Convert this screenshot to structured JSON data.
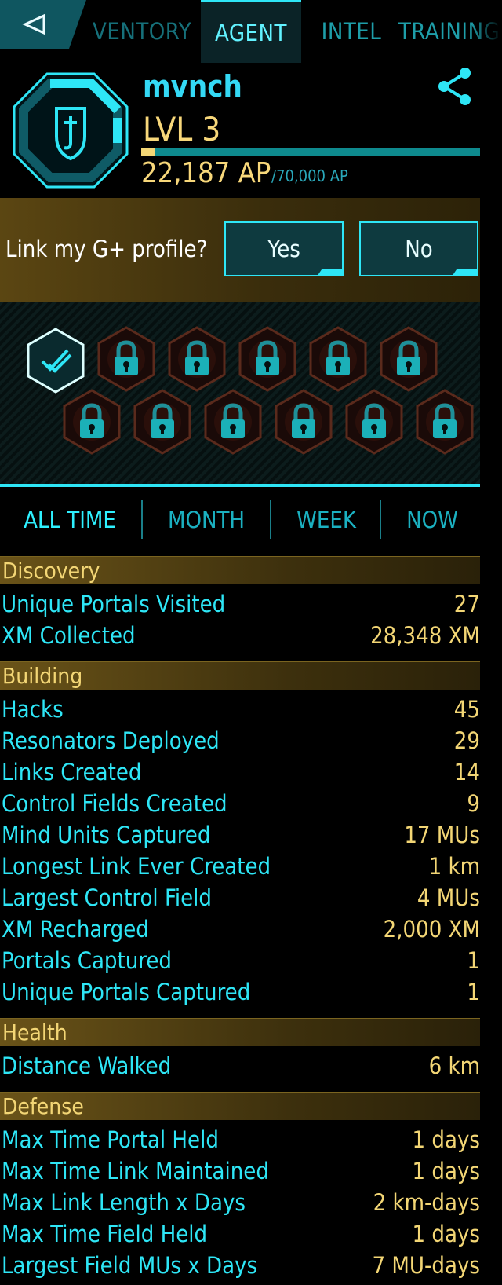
{
  "tabs": {
    "inventory": "VENTORY",
    "agent": "AGENT",
    "intel": "INTEL",
    "training": "TRAINING"
  },
  "agent": {
    "name": "mvnch",
    "level": "LVL 3",
    "ap": "22,187 AP",
    "ap_max": "/70,000 AP",
    "level_progress_fraction": 0.04
  },
  "gplus": {
    "prompt": "Link my G+ profile?",
    "yes": "Yes",
    "no": "No"
  },
  "badges": {
    "unlocked_icon": "double-check-badge-icon",
    "locked_icon": "lock-badge-icon",
    "row1_count": 6,
    "row2_count": 6
  },
  "periods": [
    "ALL TIME",
    "MONTH",
    "WEEK",
    "NOW"
  ],
  "stats": {
    "discovery": {
      "title": "Discovery",
      "rows": [
        {
          "label": "Unique Portals Visited",
          "value": "27"
        },
        {
          "label": "XM Collected",
          "value": "28,348 XM"
        }
      ]
    },
    "building": {
      "title": "Building",
      "rows": [
        {
          "label": "Hacks",
          "value": "45"
        },
        {
          "label": "Resonators Deployed",
          "value": "29"
        },
        {
          "label": "Links Created",
          "value": "14"
        },
        {
          "label": "Control Fields Created",
          "value": "9"
        },
        {
          "label": "Mind Units Captured",
          "value": "17 MUs"
        },
        {
          "label": "Longest Link Ever Created",
          "value": "1 km"
        },
        {
          "label": "Largest Control Field",
          "value": "4 MUs"
        },
        {
          "label": "XM Recharged",
          "value": "2,000 XM"
        },
        {
          "label": "Portals Captured",
          "value": "1"
        },
        {
          "label": "Unique Portals Captured",
          "value": "1"
        }
      ]
    },
    "health": {
      "title": "Health",
      "rows": [
        {
          "label": "Distance Walked",
          "value": "6 km"
        }
      ]
    },
    "defense": {
      "title": "Defense",
      "rows": [
        {
          "label": "Max Time Portal Held",
          "value": "1 days"
        },
        {
          "label": "Max Time Link Maintained",
          "value": "1 days"
        },
        {
          "label": "Max Link Length x Days",
          "value": "2 km-days"
        },
        {
          "label": "Max Time Field Held",
          "value": "1 days"
        },
        {
          "label": "Largest Field MUs x Days",
          "value": "7 MU-days"
        }
      ]
    }
  },
  "colors": {
    "cyan": "#2ee6f6",
    "gold": "#f3d675",
    "section_gold": "#6a5318"
  }
}
